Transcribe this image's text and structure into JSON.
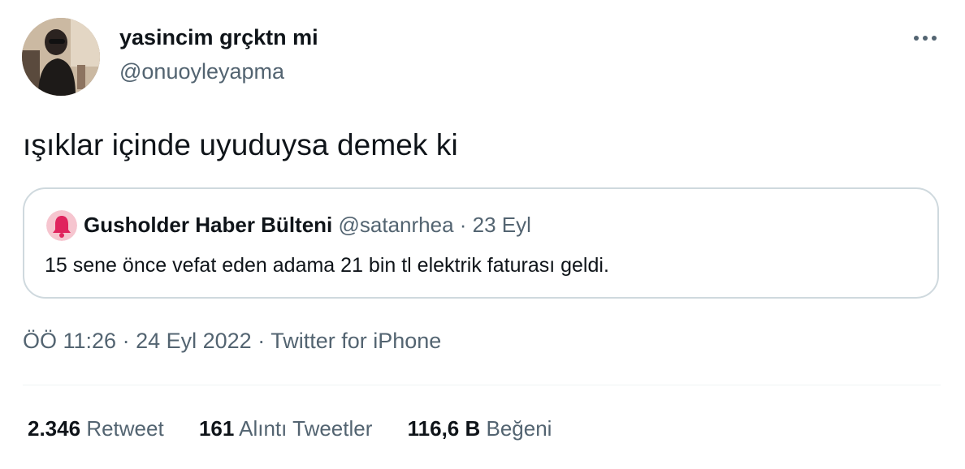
{
  "author": {
    "display_name": "yasincim grçktn mi",
    "handle": "@onuoyleyapma"
  },
  "tweet": {
    "text": "ışıklar içinde uyuduysa demek ki"
  },
  "quoted_tweet": {
    "display_name": "Gusholder Haber Bülteni",
    "handle": "@satanrhea",
    "separator": " · ",
    "date": "23 Eyl",
    "text": "15 sene önce vefat eden adama 21 bin tl elektrik faturası geldi."
  },
  "meta": {
    "time": "ÖÖ 11:26",
    "date": "24 Eyl 2022",
    "source": "Twitter for iPhone",
    "separator": " · "
  },
  "stats": {
    "retweets_count": "2.346",
    "retweets_label": "Retweet",
    "quotes_count": "161",
    "quotes_label": "Alıntı Tweetler",
    "likes_count": "116,6 B",
    "likes_label": "Beğeni"
  },
  "colors": {
    "text": "#0f1419",
    "secondary": "#536471",
    "border": "#cfd9de",
    "bell_red": "#e0245e"
  },
  "icons": {
    "more": "more-horizontal-icon",
    "quoted_avatar": "bell-icon"
  }
}
